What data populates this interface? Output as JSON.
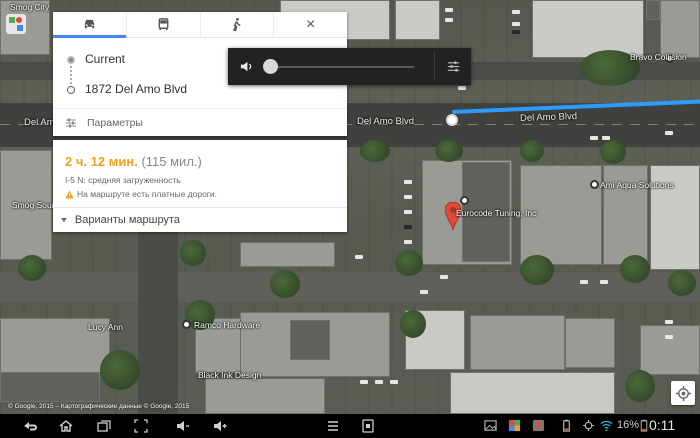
{
  "directions": {
    "modes": [
      {
        "name": "car-icon",
        "active": true
      },
      {
        "name": "transit-icon",
        "active": false
      },
      {
        "name": "walk-icon",
        "active": false
      }
    ],
    "close_label": "×",
    "origin": "Current",
    "destination": "1872 Del Amo Blvd",
    "options_label": "Параметры"
  },
  "route_summary": {
    "hours_value": "2",
    "hours_unit": "ч.",
    "minutes_value": "12",
    "minutes_unit": "мин.",
    "distance": "(115 мил.)",
    "traffic_note": "I-5 N: средняя загруженность",
    "toll_warning": "На маршруте есть платные дороги.",
    "alternatives_label": "Варианты маршрута",
    "accent_color": "#f0a11b"
  },
  "volume_popup": {
    "level": 0
  },
  "map_labels": {
    "top_left": "Smog City",
    "del_amo_left": "Del Amo Blvd",
    "del_amo_mid": "Del Amo Blvd",
    "del_amo_right": "Del Amo Blvd",
    "bravo": "Bravo Collision",
    "ami_aqua": "Ami Aqua Solutions",
    "eurocode": "Eurocode Tuning, Inc",
    "smog_source": "Smog Source",
    "lucy_ann": "Lucy Ann",
    "ramco": "Ramco Hardware",
    "black_ink": "Black Ink Design"
  },
  "copyright": "© Google, 2015 – Картографические данные © Google, 2015",
  "route_color": "#2f9bff",
  "status_bar": {
    "battery": "16%",
    "time": "0:11"
  }
}
